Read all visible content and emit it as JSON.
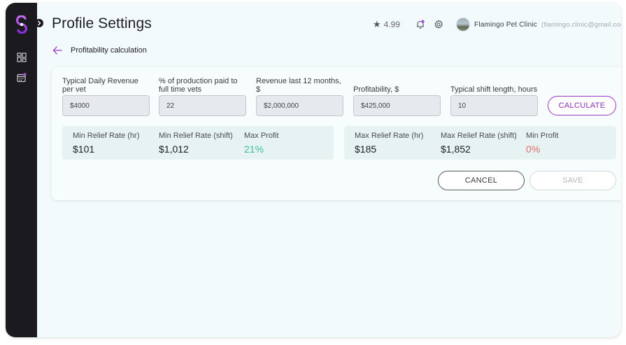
{
  "header": {
    "title": "Profile Settings",
    "rating": "4.99",
    "rating_icon": "star-icon",
    "notification_icon": "bell-icon",
    "settings_icon": "gear-icon",
    "clinic_name": "Flamingo Pet Clinic",
    "clinic_email": "(flamingo.clinic@gmail.com)"
  },
  "sidebar": {
    "logo_icon": "app-logo",
    "items": [
      {
        "icon": "dashboard-icon"
      },
      {
        "icon": "calendar-icon",
        "badge_color": "#a44ee0"
      }
    ]
  },
  "section": {
    "title": "Profitability calculation",
    "back_icon": "back-arrow-icon"
  },
  "form": {
    "fields": [
      {
        "label": "Typical Daily Revenue per vet",
        "value": "$4000"
      },
      {
        "label": "% of production paid to full time vets",
        "value": "22"
      },
      {
        "label": "Revenue last 12 months, $",
        "value": "$2,000,000"
      },
      {
        "label": "Profitability, $",
        "value": "$425,000"
      },
      {
        "label": "Typical shift length, hours",
        "value": "10"
      }
    ],
    "calculate_label": "CALCULATE"
  },
  "results": {
    "min": [
      {
        "label": "Min Relief Rate (hr)",
        "value": "$101"
      },
      {
        "label": "Min Relief Rate (shift)",
        "value": "$1,012"
      },
      {
        "label": "Max Profit",
        "value": "21%"
      }
    ],
    "max": [
      {
        "label": "Max Relief Rate (hr)",
        "value": "$185"
      },
      {
        "label": "Max Relief Rate (shift)",
        "value": "$1,852"
      },
      {
        "label": "Min Profit",
        "value": "0%"
      }
    ]
  },
  "actions": {
    "cancel_label": "CANCEL",
    "save_label": "SAVE"
  },
  "colors": {
    "accent": "#9b36c9",
    "sidebar": "#1b1a1f",
    "positive": "#3cbf9e",
    "negative": "#e06b6b",
    "result_bg": "#e6f3f2"
  }
}
